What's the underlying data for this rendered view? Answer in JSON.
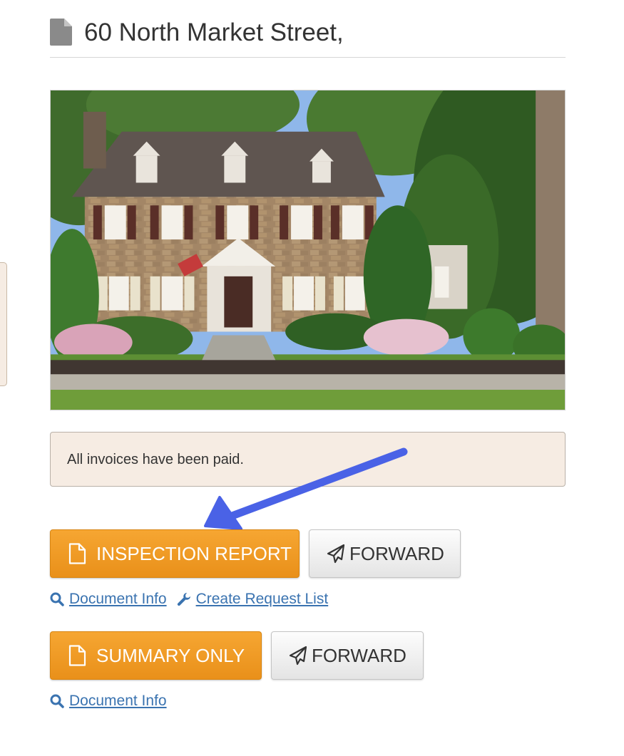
{
  "header": {
    "title": "60 North Market Street,",
    "icon": "document-icon"
  },
  "alert": {
    "text": "All invoices have been paid.",
    "background": "#f6ece3"
  },
  "annotation": {
    "icon": "blue-arrow-icon",
    "color": "#4a62e6"
  },
  "reports": [
    {
      "button_label": "INSPECTION REPORT",
      "button_icon": "document-outline-icon",
      "forward_label": "FORWARD",
      "forward_icon": "paper-plane-icon",
      "links": [
        {
          "label": "Document Info",
          "icon": "search-icon"
        },
        {
          "label": "Create Request List",
          "icon": "wrench-icon"
        }
      ]
    },
    {
      "button_label": "SUMMARY ONLY",
      "button_icon": "document-outline-icon",
      "forward_label": "FORWARD",
      "forward_icon": "paper-plane-icon",
      "links": [
        {
          "label": "Document Info",
          "icon": "search-icon"
        }
      ]
    }
  ],
  "colors": {
    "primary_button": "#f0a02a",
    "link": "#3a73b0",
    "text": "#333333"
  }
}
